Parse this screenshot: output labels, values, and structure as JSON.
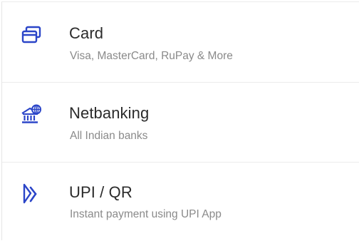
{
  "payment_options": [
    {
      "title": "Card",
      "subtitle": "Visa, MasterCard, RuPay & More",
      "icon": "card-icon"
    },
    {
      "title": "Netbanking",
      "subtitle": "All Indian banks",
      "icon": "bank-globe-icon"
    },
    {
      "title": "UPI / QR",
      "subtitle": "Instant payment using UPI App",
      "icon": "upi-icon"
    }
  ],
  "colors": {
    "icon_accent": "#2b45c8",
    "title_text": "#2b2b2b",
    "subtitle_text": "#8a8a8a",
    "divider": "#ececec"
  }
}
